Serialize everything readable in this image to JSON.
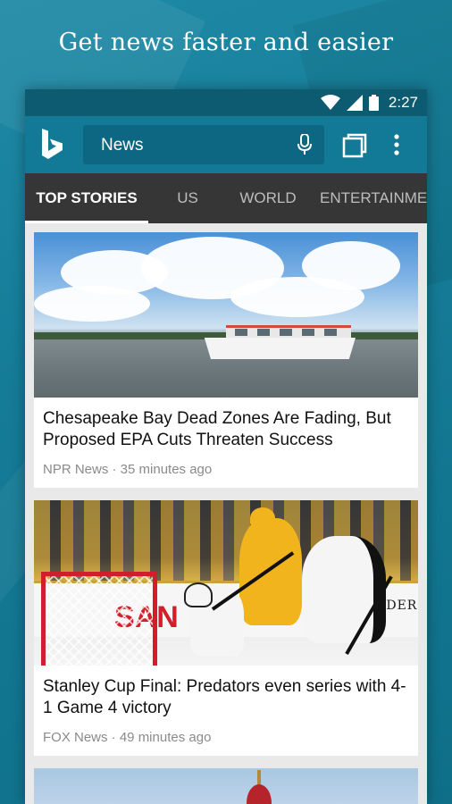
{
  "promo": {
    "headline": "Get news faster and easier"
  },
  "status_bar": {
    "time": "2:27",
    "icons": [
      "wifi-icon",
      "signal-icon",
      "battery-icon"
    ]
  },
  "app_bar": {
    "logo": "bing-logo",
    "search_text": "News",
    "icons": [
      "microphone-icon",
      "tabs-icon",
      "more-vert-icon"
    ]
  },
  "tabs": [
    {
      "label": "TOP STORIES",
      "active": true
    },
    {
      "label": "US",
      "active": false
    },
    {
      "label": "WORLD",
      "active": false
    },
    {
      "label": "ENTERTAINME",
      "active": false
    }
  ],
  "articles": [
    {
      "title": "Chesapeake Bay Dead Zones Are Fading, But Proposed EPA Cuts Threaten Success",
      "meta": "NPR News · 35 minutes ago"
    },
    {
      "title": "Stanley Cup Final: Predators even series with 4-1 Game 4 victory",
      "meta": "FOX News · 49 minutes ago"
    }
  ],
  "image_text": {
    "arena_board": "ANDERBILT",
    "board_partial": "SAN"
  },
  "colors": {
    "background": "#157c97",
    "status_bar": "#0d5b71",
    "app_bar": "#127a96",
    "tab_bar": "#363636"
  }
}
